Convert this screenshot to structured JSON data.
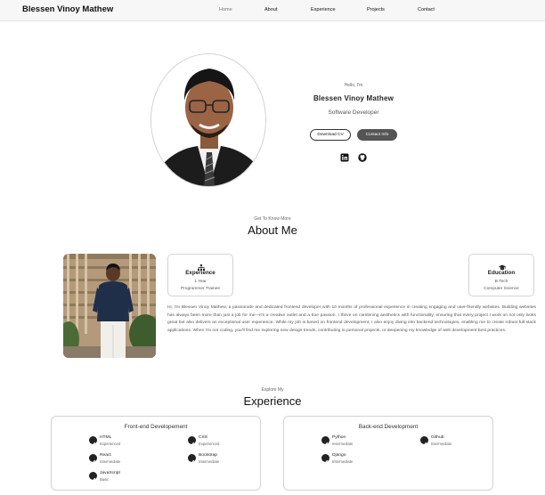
{
  "nav": {
    "brand": "Blessen Vinoy Mathew",
    "links": [
      "Home",
      "About",
      "Experience",
      "Projects",
      "Contact"
    ]
  },
  "hero": {
    "hello": "Hello, I'm",
    "name": "Blessen Vinoy Mathew",
    "role": "Software Developer",
    "buttons": {
      "download": "Download CV",
      "contact": "Contact Info"
    },
    "socials": [
      "linkedin-icon",
      "github-icon"
    ]
  },
  "about": {
    "subtitle": "Get To Know More",
    "title": "About Me",
    "cards": [
      {
        "icon": "hierarchy-icon",
        "title": "Experience",
        "line1": "1 Year",
        "line2": "Programmer Trainee"
      },
      {
        "icon": "graduation-cap-icon",
        "title": "Education",
        "line1": "B.Tech",
        "line2": "Computer Science"
      }
    ],
    "paragraph": "Hi, I'm Blessen Vinoy Mathew, a passionate and dedicated frontend developer with 10 months of professional experience in creating engaging and user-friendly websites. Building websites has always been more than just a job for me—it's a creative outlet and a true passion. I thrive on combining aesthetics with functionality, ensuring that every project I work on not only looks great but also delivers an exceptional user experience. While my job is based on frontend development, I also enjoy diving into backend technologies, enabling me to create robust full-stack applications. When I'm not coding, you'll find me exploring new design trends, contributing to personal projects, or deepening my knowledge of web development best practices."
  },
  "experience": {
    "subtitle": "Explore My",
    "title": "Experience",
    "frontend": {
      "title": "Front-end Developement",
      "skills": [
        {
          "name": "HTML",
          "level": "Experienced"
        },
        {
          "name": "CSS",
          "level": "Experienced"
        },
        {
          "name": "React",
          "level": "Intermediate"
        },
        {
          "name": "Bootstrap",
          "level": "Intermediate"
        },
        {
          "name": "JavaScript",
          "level": "Basic"
        }
      ]
    },
    "backend": {
      "title": "Back-end Development",
      "skills": [
        {
          "name": "Python",
          "level": "Intermediate"
        },
        {
          "name": "Github",
          "level": "Intermediate"
        },
        {
          "name": "Django",
          "level": "Intermediate"
        }
      ]
    }
  },
  "colors": {
    "accent": "#555555",
    "text": "#222222",
    "nav_bg": "#f7f7f7"
  }
}
